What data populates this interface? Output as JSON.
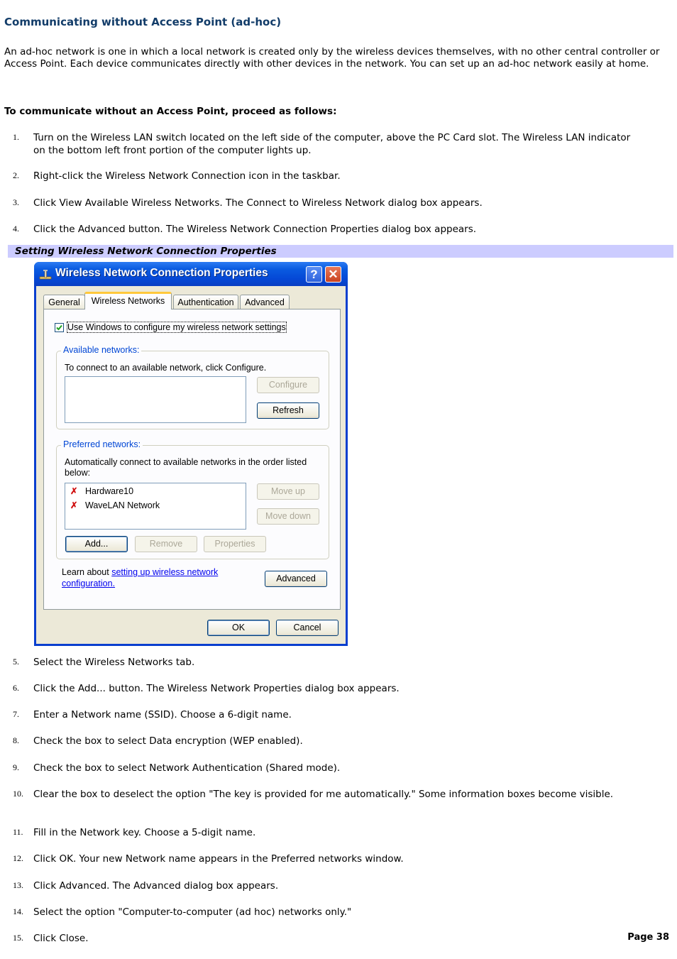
{
  "heading": "Communicating without Access Point (ad-hoc)",
  "intro": "An ad-hoc network is one in which a local network is created only by the wireless devices themselves, with no other central controller or Access Point. Each device communicates directly with other devices in the network. You can set up an ad-hoc network easily at home.",
  "lead": "To communicate without an Access Point, proceed as follows:",
  "steps": [
    {
      "num": "1.",
      "text": "Turn on the Wireless LAN switch located on the left side of the computer, above the PC Card slot. The Wireless LAN indicator on the bottom left front portion of the computer lights up."
    },
    {
      "num": "2.",
      "text": "Right-click the Wireless Network Connection icon in the taskbar."
    },
    {
      "num": "3.",
      "text": "Click View Available Wireless Networks. The Connect to Wireless Network dialog box appears."
    },
    {
      "num": "4.",
      "text": "Click the Advanced button. The Wireless Network Connection Properties dialog box appears."
    },
    {
      "num": "5.",
      "text": "Select the Wireless Networks tab."
    },
    {
      "num": "6.",
      "text": "Click the Add... button. The Wireless Network Properties dialog box appears."
    },
    {
      "num": "7.",
      "text": "Enter a Network name (SSID). Choose a 6-digit name."
    },
    {
      "num": "8.",
      "text": "Check the box to select Data encryption (WEP enabled)."
    },
    {
      "num": "9.",
      "text": "Check the box to select Network Authentication (Shared mode)."
    },
    {
      "num": "10.",
      "text": "Clear the box to deselect the option \"The key is provided for me automatically.\" Some information boxes become visible."
    },
    {
      "num": "11.",
      "text": "Fill in the Network key. Choose a 5-digit name."
    },
    {
      "num": "12.",
      "text": "Click OK. Your new Network name appears in the Preferred networks window."
    },
    {
      "num": "13.",
      "text": "Click Advanced. The Advanced dialog box appears."
    },
    {
      "num": "14.",
      "text": "Select the option \"Computer-to-computer (ad hoc) networks only.\""
    },
    {
      "num": "15.",
      "text": "Click Close."
    }
  ],
  "figure_caption": "Setting Wireless Network Connection Properties",
  "dialog": {
    "title": "Wireless Network Connection Properties",
    "help_label": "?",
    "close_label": "✕",
    "tabs": [
      "General",
      "Wireless Networks",
      "Authentication",
      "Advanced"
    ],
    "active_tab": "Wireless Networks",
    "use_windows_checkbox": {
      "label": "Use Windows to configure my wireless network settings",
      "checked": true
    },
    "available": {
      "legend": "Available networks:",
      "description": "To connect to an available network, click Configure.",
      "items": [],
      "configure_label": "Configure",
      "refresh_label": "Refresh"
    },
    "preferred": {
      "legend": "Preferred networks:",
      "description": "Automatically connect to available networks in the order listed below:",
      "items": [
        "Hardware10",
        "WaveLAN Network"
      ],
      "move_up_label": "Move up",
      "move_down_label": "Move down",
      "add_label": "Add...",
      "remove_label": "Remove",
      "properties_label": "Properties"
    },
    "learn_prefix": "Learn about ",
    "learn_link": "setting up wireless network configuration.",
    "advanced_label": "Advanced",
    "ok_label": "OK",
    "cancel_label": "Cancel"
  },
  "page_label": "Page 38"
}
